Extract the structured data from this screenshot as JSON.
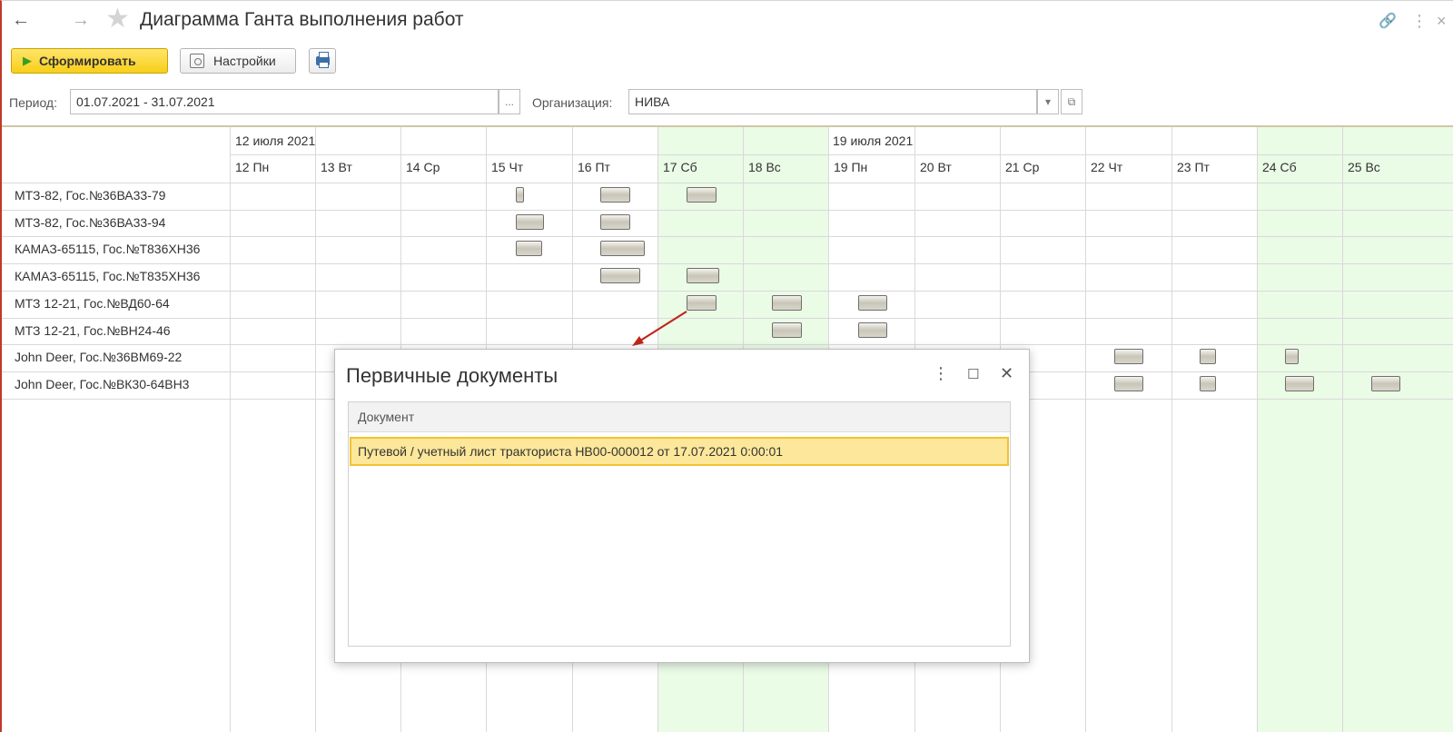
{
  "window": {
    "title": "Диаграмма Ганта выполнения работ",
    "back_icon": "←",
    "forward_icon": "→",
    "star_icon": "★",
    "link_icon": "🔗",
    "menu_icon": "⋮",
    "close_icon": "×"
  },
  "toolbar": {
    "generate_label": "Сформировать",
    "settings_label": "Настройки"
  },
  "filters": {
    "period_label": "Период:",
    "period_value": "01.07.2021 - 31.07.2021",
    "period_btn": "...",
    "org_label": "Организация:",
    "org_value": "НИВА",
    "org_dropdown": "▾",
    "org_open": "⧉"
  },
  "gantt": {
    "weeks": [
      "12 июля 2021",
      "19 июля 2021"
    ],
    "days": [
      "12 Пн",
      "13 Вт",
      "14 Ср",
      "15 Чт",
      "16 Пт",
      "17 Сб",
      "18 Вс",
      "19 Пн",
      "20 Вт",
      "21 Ср",
      "22 Чт",
      "23 Пт",
      "24 Сб",
      "25 Вс"
    ],
    "rows": [
      "МТЗ-82, Гос.№36ВА33-79",
      "МТЗ-82, Гос.№36ВА33-94",
      "КАМАЗ-65115, Гос.№Т836ХН36",
      "КАМАЗ-65115, Гос.№Т835ХН36",
      "МТЗ 12-21, Гос.№ВД60-64",
      "МТЗ 12-21, Гос.№ВН24-46",
      "John Deer, Гос.№36ВМ69-22",
      "John Deer, Гос.№ВК30-64ВН3"
    ]
  },
  "dialog": {
    "title": "Первичные документы",
    "menu_icon": "⋮",
    "maximize_icon": "☐",
    "close_icon": "✕",
    "column_header": "Документ",
    "rows": [
      "Путевой / учетный лист тракториста НВ00-000012 от 17.07.2021 0:00:01"
    ]
  }
}
